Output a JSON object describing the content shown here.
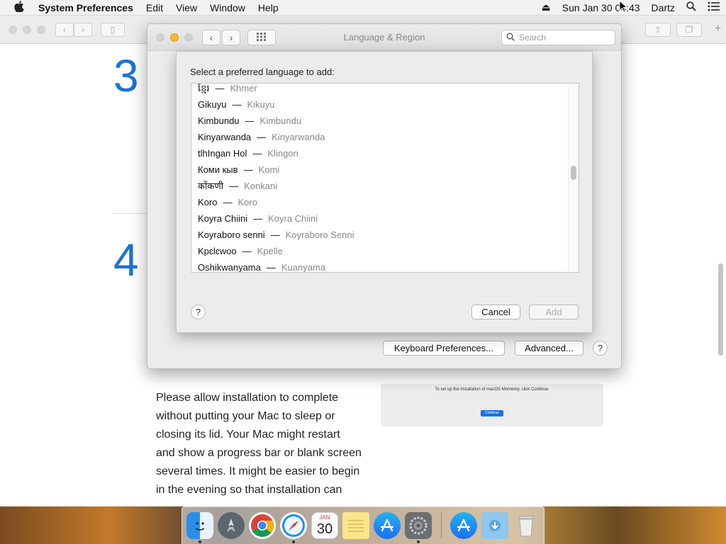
{
  "menubar": {
    "app_name": "System Preferences",
    "items": [
      "Edit",
      "View",
      "Window",
      "Help"
    ],
    "clock": "Sun Jan 30  04:43",
    "user": "Dartz"
  },
  "browser": {
    "step3": "3",
    "step4": "4",
    "article_text": "Please allow installation to complete without putting your Mac to sleep or closing its lid. Your Mac might restart and show a progress bar or blank screen several times. It might be easier to begin in the evening so that installation can",
    "image_caption": "To set up the installation of macOS Monterey, click Continue.",
    "image_button": "Continue"
  },
  "window": {
    "title": "Language & Region",
    "search_placeholder": "Search",
    "keyboard_button": "Keyboard Preferences...",
    "advanced_button": "Advanced...",
    "help": "?"
  },
  "sheet": {
    "prompt": "Select a preferred language to add:",
    "cancel": "Cancel",
    "add": "Add",
    "help": "?",
    "languages": [
      {
        "native": "ខ្មែរ",
        "english": "Khmer"
      },
      {
        "native": "Gikuyu",
        "english": "Kikuyu"
      },
      {
        "native": "Kimbundu",
        "english": "Kimbundu"
      },
      {
        "native": "Kinyarwanda",
        "english": "Kinyarwanda"
      },
      {
        "native": "tlhIngan Hol",
        "english": "Klingon"
      },
      {
        "native": "Коми кыв",
        "english": "Komi"
      },
      {
        "native": "कोंकणी",
        "english": "Konkani"
      },
      {
        "native": "Koro",
        "english": "Koro"
      },
      {
        "native": "Koyra Chiini",
        "english": "Koyra Chiini"
      },
      {
        "native": "Koyraboro senni",
        "english": "Koyraboro Senni"
      },
      {
        "native": "Kpɛlɛwoo",
        "english": "Kpelle"
      },
      {
        "native": "Oshikwanyama",
        "english": "Kuanyama"
      }
    ],
    "separator": "—"
  },
  "dock": {
    "calendar_month": "JAN",
    "calendar_day": "30"
  }
}
